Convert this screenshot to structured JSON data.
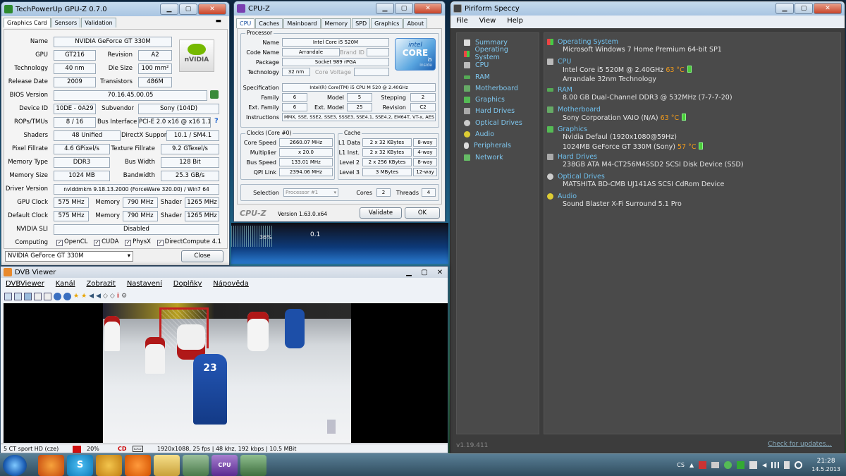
{
  "gpuz": {
    "title": "TechPowerUp GPU-Z 0.7.0",
    "tabs": [
      "Graphics Card",
      "Sensors",
      "Validation"
    ],
    "name_label": "Name",
    "name": "NVIDIA GeForce GT 330M",
    "gpu_label": "GPU",
    "gpu": "GT216",
    "revision_label": "Revision",
    "revision": "A2",
    "technology_label": "Technology",
    "technology": "40 nm",
    "diesize_label": "Die Size",
    "diesize": "100 mm²",
    "release_label": "Release Date",
    "release": "2009",
    "transistors_label": "Transistors",
    "transistors": "486M",
    "bios_label": "BIOS Version",
    "bios": "70.16.45.00.05",
    "deviceid_label": "Device ID",
    "deviceid": "10DE - 0A29",
    "subvendor_label": "Subvendor",
    "subvendor": "Sony (104D)",
    "rops_label": "ROPs/TMUs",
    "rops": "8 / 16",
    "businterface_label": "Bus Interface",
    "businterface": "PCI-E 2.0 x16 @ x16 1.1",
    "shaders_label": "Shaders",
    "shaders": "48 Unified",
    "directx_label": "DirectX Support",
    "directx": "10.1 / SM4.1",
    "pixel_label": "Pixel Fillrate",
    "pixel": "4.6 GPixel/s",
    "texture_label": "Texture Fillrate",
    "texture": "9.2 GTexel/s",
    "memtype_label": "Memory Type",
    "memtype": "DDR3",
    "buswidth_label": "Bus Width",
    "buswidth": "128 Bit",
    "memsize_label": "Memory Size",
    "memsize": "1024 MB",
    "bandwidth_label": "Bandwidth",
    "bandwidth": "25.3 GB/s",
    "driver_label": "Driver Version",
    "driver": "nvlddmkm 9.18.13.2000 (ForceWare 320.00) / Win7 64",
    "gpuclock_label": "GPU Clock",
    "gpuclock": "575 MHz",
    "memory_label": "Memory",
    "memclock": "790 MHz",
    "shader_label": "Shader",
    "shaderclock": "1265 MHz",
    "defclock_label": "Default Clock",
    "defclock": "575 MHz",
    "defmem": "790 MHz",
    "defshader": "1265 MHz",
    "sli_label": "NVIDIA SLI",
    "sli": "Disabled",
    "computing_label": "Computing",
    "opencl": "OpenCL",
    "cuda": "CUDA",
    "physx": "PhysX",
    "directcompute": "DirectCompute 4.1",
    "selected_card": "NVIDIA GeForce GT 330M",
    "close": "Close",
    "logo": "nVIDIA",
    "question": "?"
  },
  "cpuz": {
    "title": "CPU-Z",
    "tabs": [
      "CPU",
      "Caches",
      "Mainboard",
      "Memory",
      "SPD",
      "Graphics",
      "About"
    ],
    "processor_group": "Processor",
    "name_label": "Name",
    "name": "Intel Core i5 520M",
    "codename_label": "Code Name",
    "codename": "Arrandale",
    "brandid_label": "Brand ID",
    "package_label": "Package",
    "package": "Socket 989 rPGA",
    "technology_label": "Technology",
    "technology": "32 nm",
    "corevoltage_label": "Core Voltage",
    "spec_label": "Specification",
    "spec": "Intel(R) Core(TM) i5 CPU      M 520  @ 2.40GHz",
    "family_label": "Family",
    "family": "6",
    "model_label": "Model",
    "model": "5",
    "stepping_label": "Stepping",
    "stepping": "2",
    "extfamily_label": "Ext. Family",
    "extfamily": "6",
    "extmodel_label": "Ext. Model",
    "extmodel": "25",
    "revision_label": "Revision",
    "revision": "C2",
    "instructions_label": "Instructions",
    "instructions": "MMX, SSE, SSE2, SSE3, SSSE3, SSE4.1, SSE4.2, EM64T, VT-x, AES",
    "clocks_group": "Clocks (Core #0)",
    "corespeed_label": "Core Speed",
    "corespeed": "2660.07 MHz",
    "multiplier_label": "Multiplier",
    "multiplier": "x 20.0",
    "busspeed_label": "Bus Speed",
    "busspeed": "133.01 MHz",
    "qpilink_label": "QPI Link",
    "qpilink": "2394.06 MHz",
    "cache_group": "Cache",
    "l1d_label": "L1 Data",
    "l1d": "2 x 32 KBytes",
    "l1d_way": "8-way",
    "l1i_label": "L1 Inst.",
    "l1i": "2 x 32 KBytes",
    "l1i_way": "4-way",
    "l2_label": "Level 2",
    "l2": "2 x 256 KBytes",
    "l2_way": "8-way",
    "l3_label": "Level 3",
    "l3": "3 MBytes",
    "l3_way": "12-way",
    "selection_label": "Selection",
    "selection": "Processor #1",
    "cores_label": "Cores",
    "cores": "2",
    "threads_label": "Threads",
    "threads": "4",
    "brand": "CPU-Z",
    "version": "Version 1.63.0.x64",
    "validate": "Validate",
    "ok": "OK",
    "intel_logo": "intel",
    "intel_core": "CORE",
    "intel_i5": "i5",
    "intel_inside": "inside"
  },
  "speccy": {
    "title": "Piriform Speccy",
    "menu": [
      "File",
      "View",
      "Help"
    ],
    "sidebar": [
      "Summary",
      "Operating System",
      "CPU",
      "RAM",
      "Motherboard",
      "Graphics",
      "Hard Drives",
      "Optical Drives",
      "Audio",
      "Peripherals",
      "Network"
    ],
    "os_h": "Operating System",
    "os": "Microsoft Windows 7 Home Premium 64-bit SP1",
    "cpu_h": "CPU",
    "cpu_1": "Intel Core i5 520M @ 2.40GHz",
    "cpu_temp": "63 °C",
    "cpu_2": "Arrandale 32nm Technology",
    "ram_h": "RAM",
    "ram": "8.00 GB Dual-Channel DDR3 @ 532MHz (7-7-7-20)",
    "mb_h": "Motherboard",
    "mb": "Sony Corporation VAIO (N/A)",
    "mb_temp": "63 °C",
    "gfx_h": "Graphics",
    "gfx_1": "Nvidia Defaul (1920x1080@59Hz)",
    "gfx_2": "1024MB GeForce GT 330M (Sony)",
    "gfx_temp": "57 °C",
    "hd_h": "Hard Drives",
    "hd": "238GB ATA M4-CT256M4SSD2 SCSI Disk Device (SSD)",
    "od_h": "Optical Drives",
    "od": "MATSHITA BD-CMB UJ141AS SCSI CdRom Device",
    "audio_h": "Audio",
    "audio": "Sound Blaster X-Fi Surround 5.1 Pro",
    "version": "v1.19.411",
    "check": "Check for updates..."
  },
  "dvb": {
    "title": "DVB Viewer",
    "menu": [
      "DVBViewer",
      "Kanál",
      "Zobrazit",
      "Nastavení",
      "Doplňky",
      "Nápověda"
    ],
    "channel": "5 CT sport HD (cze)",
    "signal": "20%",
    "info": "1920x1088, 25 fps | 48 khz, 192 kbps | 10.5 MBit",
    "jersey": "23"
  },
  "bgwidget": {
    "l1": "36%",
    "l2": "0.1"
  },
  "taskbar": {
    "lang": "CS",
    "time": "21:28",
    "date": "14.5.2013"
  },
  "colors": {
    "speccy_bg": "#4a4a4a",
    "speccy_link": "#6fc0ee",
    "temp": "#f29b1b",
    "accent": "#3d6fb0"
  }
}
